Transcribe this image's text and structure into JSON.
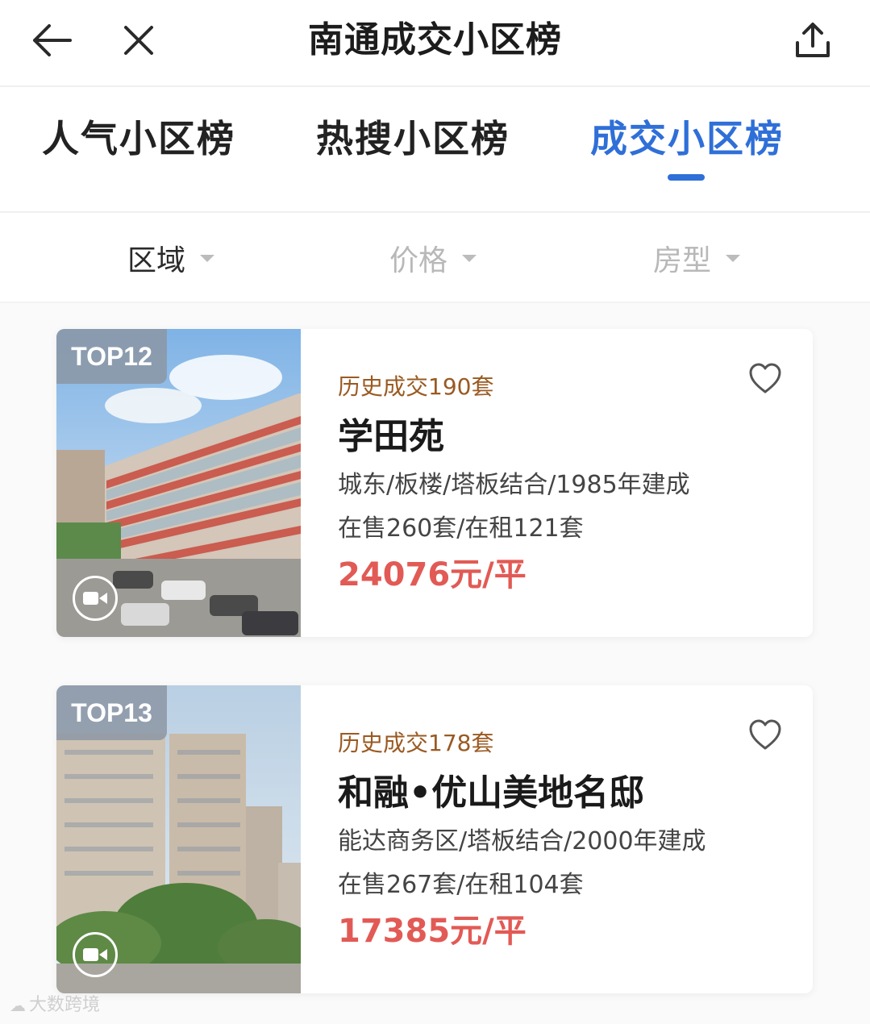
{
  "header": {
    "title": "南通成交小区榜",
    "back_icon": "arrow-left-icon",
    "close_icon": "close-icon",
    "share_icon": "share-icon"
  },
  "tabs": [
    {
      "label": "人气小区榜",
      "active": false
    },
    {
      "label": "热搜小区榜",
      "active": false
    },
    {
      "label": "成交小区榜",
      "active": true
    }
  ],
  "filters": [
    {
      "label": "区域",
      "active": true
    },
    {
      "label": "价格",
      "active": false
    },
    {
      "label": "房型",
      "active": false
    }
  ],
  "listings": [
    {
      "rank": "TOP12",
      "deals": "历史成交190套",
      "name": "学田苑",
      "desc": "城东/板楼/塔板结合/1985年建成",
      "stock": "在售260套/在租121套",
      "price": "24076元/平"
    },
    {
      "rank": "TOP13",
      "deals": "历史成交178套",
      "name": "和融•优山美地名邸",
      "desc": "能达商务区/塔板结合/2000年建成",
      "stock": "在售267套/在租104套",
      "price": "17385元/平"
    }
  ],
  "watermark": {
    "text": "大数跨境"
  },
  "colors": {
    "accent_blue": "#2f6fd8",
    "price_red": "#e25a55",
    "deals_brown": "#9a5a22"
  }
}
